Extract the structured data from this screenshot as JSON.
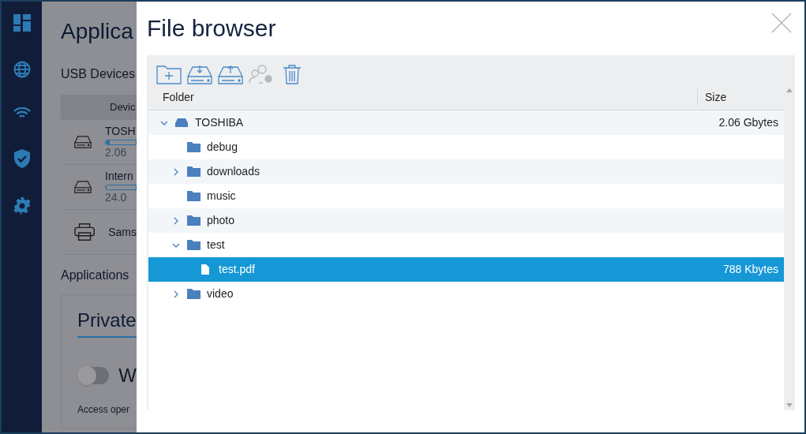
{
  "background": {
    "title": "Applica",
    "usb_heading": "USB Devices",
    "table_header": "Devic",
    "devices": [
      {
        "kind": "drive",
        "name": "TOSH",
        "size": "2.06",
        "level": 0.12
      },
      {
        "kind": "drive",
        "name": "Intern",
        "size": "24.0",
        "level": 0.02
      },
      {
        "kind": "printer",
        "name": "Sams"
      }
    ],
    "apps_heading": "Applications",
    "card_tab": "Private",
    "toggle": {
      "on": false,
      "label": "W"
    },
    "note": "Access oper"
  },
  "dialog": {
    "title": "File browser",
    "toolbar": [
      {
        "kind": "new-folder",
        "disabled": false
      },
      {
        "kind": "download",
        "disabled": false
      },
      {
        "kind": "upload",
        "disabled": false
      },
      {
        "kind": "permissions",
        "disabled": true
      },
      {
        "kind": "delete",
        "disabled": false
      }
    ],
    "columns": [
      "Folder",
      "Size"
    ],
    "tree": [
      {
        "kind": "drive",
        "name": "TOSHIBA",
        "size": "2.06 Gbytes",
        "expanded": true,
        "selected": false,
        "children": [
          {
            "kind": "folder",
            "name": "debug",
            "selected": false
          },
          {
            "kind": "folder",
            "name": "downloads",
            "expanded": false,
            "selected": false
          },
          {
            "kind": "folder",
            "name": "music",
            "selected": false
          },
          {
            "kind": "folder",
            "name": "photo",
            "expanded": false,
            "selected": false
          },
          {
            "kind": "folder",
            "name": "test",
            "expanded": true,
            "selected": false,
            "children": [
              {
                "kind": "file",
                "name": "test.pdf",
                "size": "788 Kbytes",
                "selected": true
              }
            ]
          },
          {
            "kind": "folder",
            "name": "video",
            "expanded": false,
            "selected": false
          }
        ]
      }
    ]
  }
}
